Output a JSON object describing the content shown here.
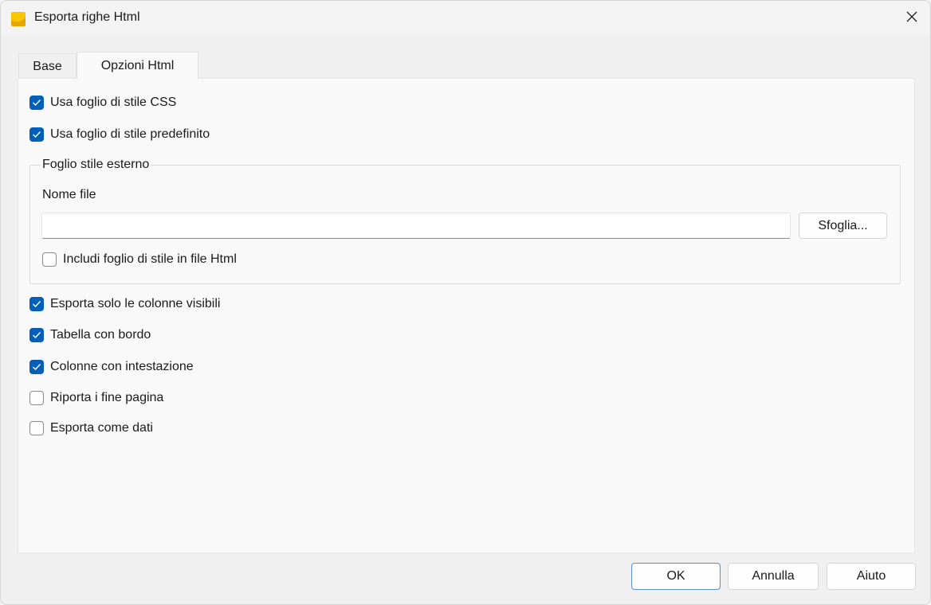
{
  "window": {
    "title": "Esporta righe Html"
  },
  "tabs": [
    {
      "label": "Base",
      "active": false
    },
    {
      "label": "Opzioni Html",
      "active": true
    }
  ],
  "options_top": [
    {
      "label": "Usa foglio di stile CSS",
      "checked": true
    },
    {
      "label": "Usa foglio di stile predefinito",
      "checked": true
    }
  ],
  "external_stylesheet": {
    "legend": "Foglio stile esterno",
    "filename_label": "Nome file",
    "filename_value": "",
    "browse_label": "Sfoglia...",
    "include_label": "Includi foglio di stile in file Html",
    "include_checked": false
  },
  "options_bottom": [
    {
      "label": "Esporta solo le colonne visibili",
      "checked": true
    },
    {
      "label": "Tabella con bordo",
      "checked": true
    },
    {
      "label": "Colonne con intestazione",
      "checked": true
    },
    {
      "label": "Riporta i fine pagina",
      "checked": false
    },
    {
      "label": "Esporta come dati",
      "checked": false
    }
  ],
  "buttons": {
    "ok": "OK",
    "cancel": "Annulla",
    "help": "Aiuto"
  },
  "colors": {
    "accent": "#005fb8",
    "app_icon": "#f5c400"
  },
  "icons": {
    "app": "banana-app-icon",
    "close": "close-icon",
    "check": "checkmark-icon"
  }
}
